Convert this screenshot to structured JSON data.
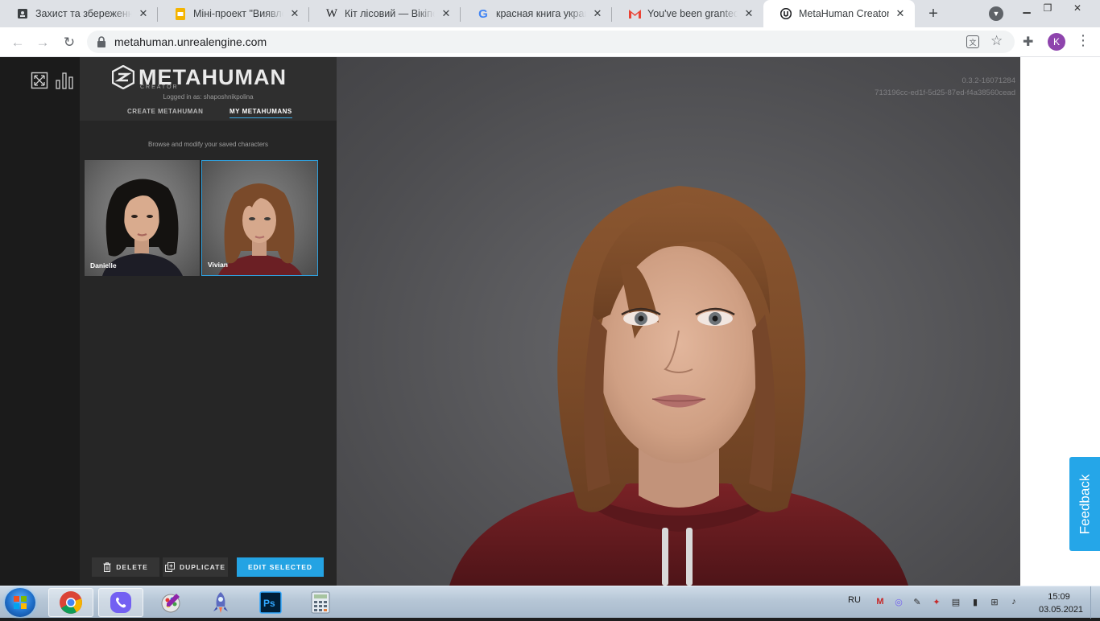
{
  "browser": {
    "tabs": [
      {
        "title": "Захист та збереження",
        "icon": "classroom-icon",
        "active": false
      },
      {
        "title": "Міні-проект \"Виявлення",
        "icon": "slides-icon",
        "active": false
      },
      {
        "title": "Кіт лісовий — Вікіпедія",
        "icon": "wikipedia-icon",
        "active": false
      },
      {
        "title": "красная книга украины",
        "icon": "google-icon",
        "active": false
      },
      {
        "title": "You've been granted Ea",
        "icon": "gmail-icon",
        "active": false
      },
      {
        "title": "MetaHuman Creator",
        "icon": "unreal-icon",
        "active": true
      }
    ],
    "url": "metahuman.unrealengine.com",
    "profile_initial": "K"
  },
  "app": {
    "logo_text": "METAHUMAN",
    "logo_sub": "CREATOR",
    "logged_in": "Logged in as: shaposhnikpolina",
    "tabs": [
      {
        "label": "CREATE METAHUMAN",
        "active": false
      },
      {
        "label": "MY METAHUMANS",
        "active": true
      }
    ],
    "browse_text": "Browse and modify your saved characters",
    "characters": [
      {
        "name": "Danielle",
        "selected": false,
        "hair": "black"
      },
      {
        "name": "Vivian",
        "selected": true,
        "hair": "auburn"
      }
    ],
    "buttons": {
      "delete": "DELETE",
      "duplicate": "DUPLICATE",
      "edit": "EDIT SELECTED"
    },
    "version": "0.3.2-16071284",
    "build_hash": "713196cc-ed1f-5d25-87ed-f4a38560cead",
    "feedback": "Feedback",
    "accent_color": "#24a3e3"
  },
  "taskbar": {
    "apps": [
      "chrome-icon",
      "viber-icon",
      "paint-icon",
      "rocket-icon",
      "photoshop-icon",
      "calculator-icon"
    ],
    "language": "RU",
    "time": "15:09",
    "date": "03.05.2021"
  }
}
